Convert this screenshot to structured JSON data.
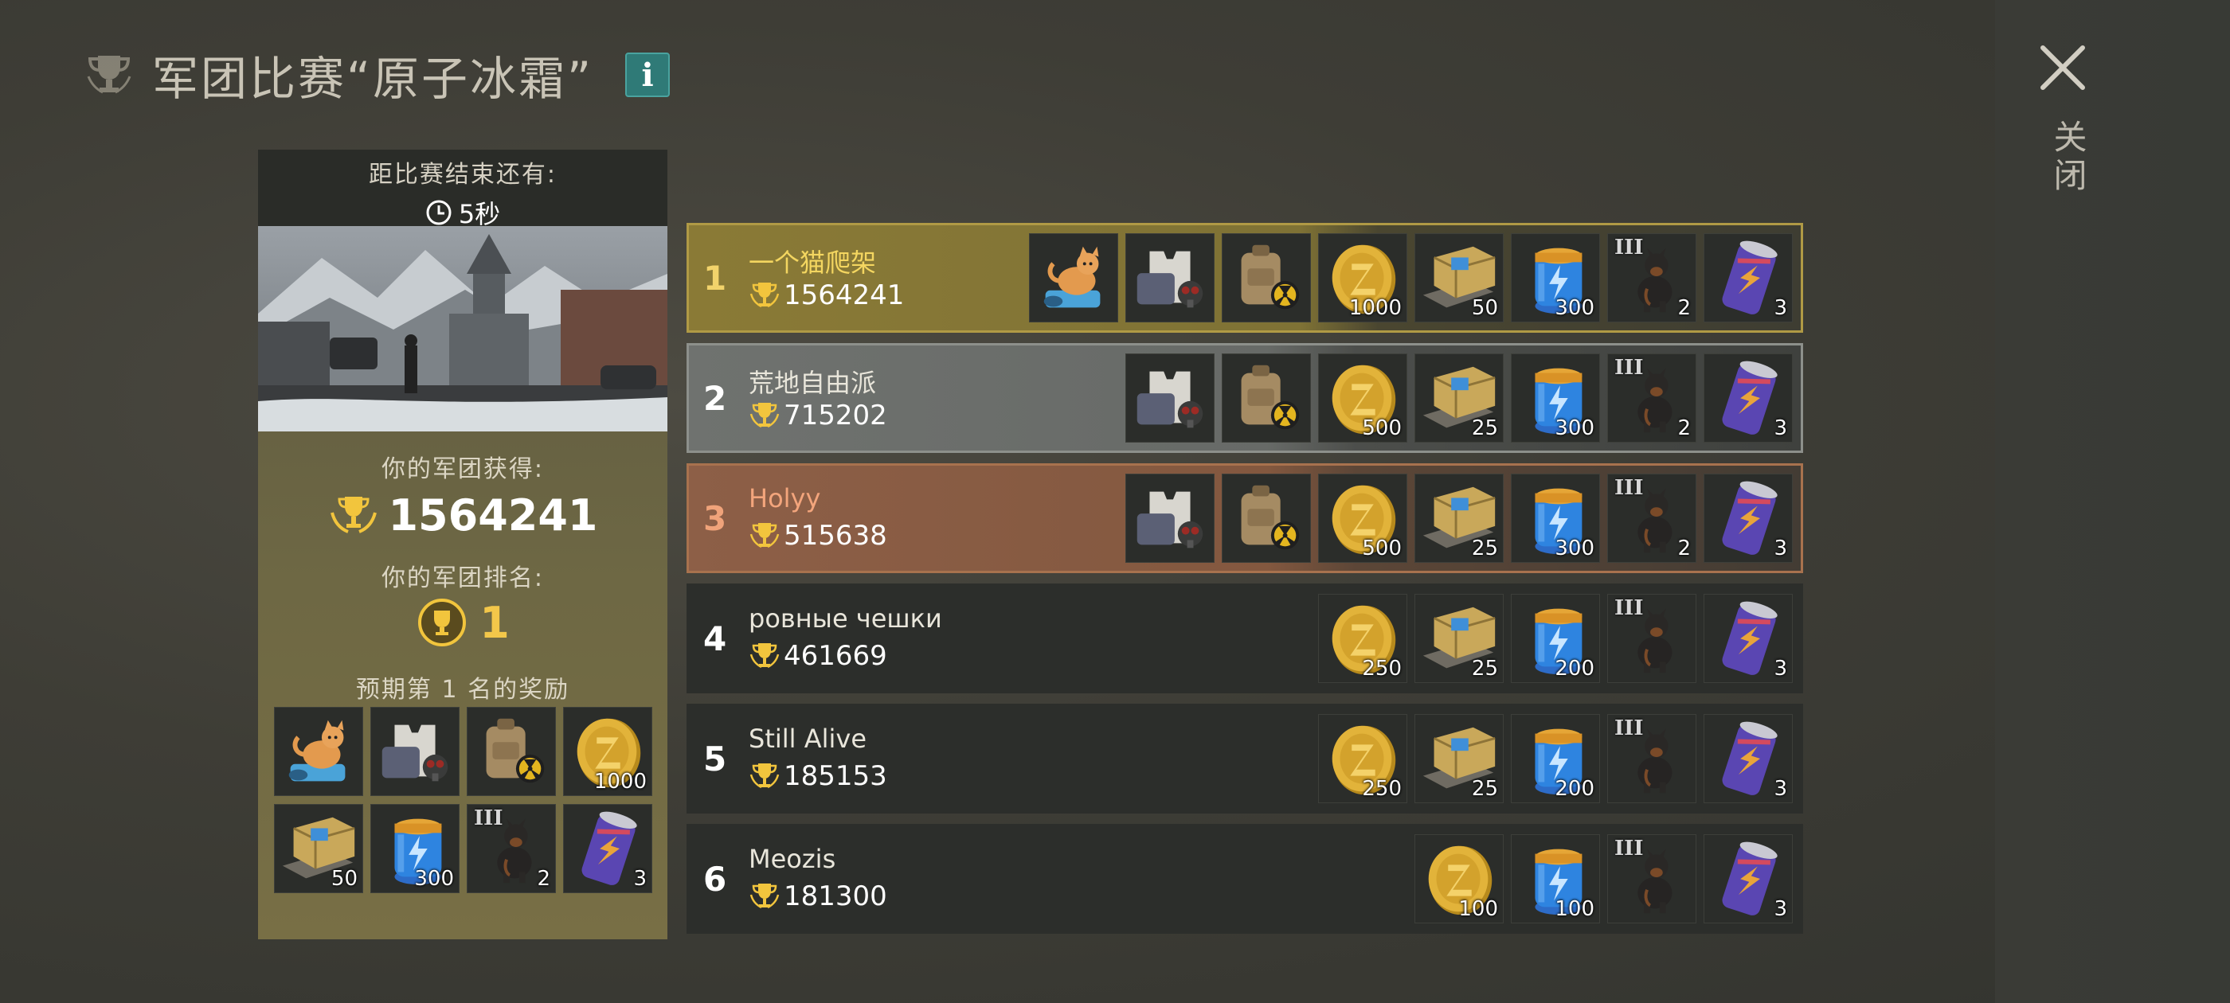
{
  "header": {
    "title": "军团比赛“原子冰霜”",
    "info_label": "i"
  },
  "close": {
    "label": "关闭"
  },
  "left_panel": {
    "timer_label": "距比赛结束还有:",
    "timer_value": "5秒",
    "earned_label": "你的军团获得:",
    "earned_value": "1564241",
    "rank_label": "你的军团排名:",
    "rank_value": "1",
    "rewards_label": "预期第 1 名的奖励",
    "rewards": [
      {
        "icon": "cat-icon",
        "qty": ""
      },
      {
        "icon": "vest-gasmask-icon",
        "qty": ""
      },
      {
        "icon": "backpack-icon",
        "qty": ""
      },
      {
        "icon": "coin-icon",
        "qty": "1000"
      },
      {
        "icon": "crate-icon",
        "qty": "50"
      },
      {
        "icon": "battery-icon",
        "qty": "300"
      },
      {
        "icon": "dog-icon",
        "qty": "2",
        "tier": "III"
      },
      {
        "icon": "energy-can-icon",
        "qty": "3"
      }
    ]
  },
  "leaderboard": [
    {
      "rank": "1",
      "name": "一个猫爬架",
      "score": "1564241",
      "items": [
        {
          "icon": "cat-icon",
          "qty": ""
        },
        {
          "icon": "vest-gasmask-icon",
          "qty": ""
        },
        {
          "icon": "backpack-icon",
          "qty": ""
        },
        {
          "icon": "coin-icon",
          "qty": "1000"
        },
        {
          "icon": "crate-icon",
          "qty": "50"
        },
        {
          "icon": "battery-icon",
          "qty": "300"
        },
        {
          "icon": "dog-icon",
          "qty": "2",
          "tier": "III"
        },
        {
          "icon": "energy-can-icon",
          "qty": "3"
        }
      ]
    },
    {
      "rank": "2",
      "name": "荒地自由派",
      "score": "715202",
      "items": [
        {
          "icon": "vest-gasmask-icon",
          "qty": ""
        },
        {
          "icon": "backpack-icon",
          "qty": ""
        },
        {
          "icon": "coin-icon",
          "qty": "500"
        },
        {
          "icon": "crate-icon",
          "qty": "25"
        },
        {
          "icon": "battery-icon",
          "qty": "300"
        },
        {
          "icon": "dog-icon",
          "qty": "2",
          "tier": "III"
        },
        {
          "icon": "energy-can-icon",
          "qty": "3"
        }
      ]
    },
    {
      "rank": "3",
      "name": "Holyy",
      "score": "515638",
      "items": [
        {
          "icon": "vest-gasmask-icon",
          "qty": ""
        },
        {
          "icon": "backpack-icon",
          "qty": ""
        },
        {
          "icon": "coin-icon",
          "qty": "500"
        },
        {
          "icon": "crate-icon",
          "qty": "25"
        },
        {
          "icon": "battery-icon",
          "qty": "300"
        },
        {
          "icon": "dog-icon",
          "qty": "2",
          "tier": "III"
        },
        {
          "icon": "energy-can-icon",
          "qty": "3"
        }
      ]
    },
    {
      "rank": "4",
      "name": "ровные чешки",
      "score": "461669",
      "items": [
        {
          "icon": "coin-icon",
          "qty": "250"
        },
        {
          "icon": "crate-icon",
          "qty": "25"
        },
        {
          "icon": "battery-icon",
          "qty": "200"
        },
        {
          "icon": "dog-icon",
          "qty": "",
          "tier": "III"
        },
        {
          "icon": "energy-can-icon",
          "qty": "3"
        }
      ]
    },
    {
      "rank": "5",
      "name": "Still Alive",
      "score": "185153",
      "items": [
        {
          "icon": "coin-icon",
          "qty": "250"
        },
        {
          "icon": "crate-icon",
          "qty": "25"
        },
        {
          "icon": "battery-icon",
          "qty": "200"
        },
        {
          "icon": "dog-icon",
          "qty": "",
          "tier": "III"
        },
        {
          "icon": "energy-can-icon",
          "qty": "3"
        }
      ]
    },
    {
      "rank": "6",
      "name": "Meozis",
      "score": "181300",
      "items": [
        {
          "icon": "coin-icon",
          "qty": "100"
        },
        {
          "icon": "battery-icon",
          "qty": "100"
        },
        {
          "icon": "dog-icon",
          "qty": "",
          "tier": "III"
        },
        {
          "icon": "energy-can-icon",
          "qty": "3"
        }
      ]
    }
  ]
}
